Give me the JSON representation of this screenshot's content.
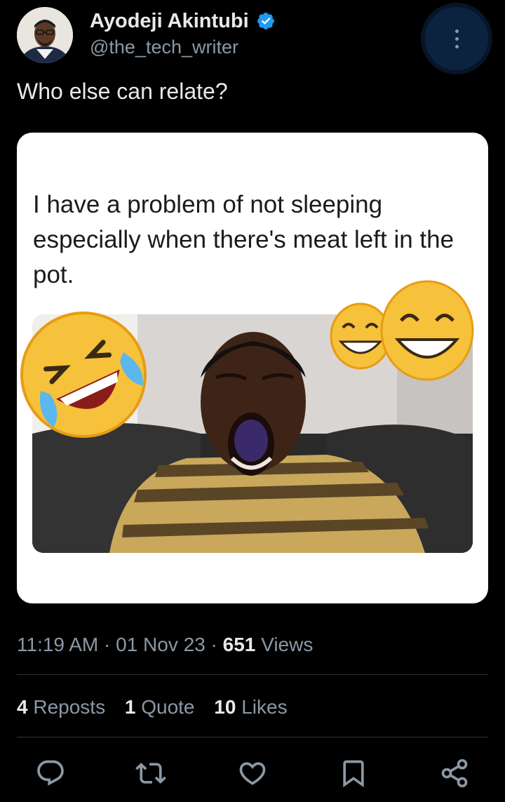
{
  "author": {
    "display_name": "Ayodeji Akintubi",
    "handle": "@the_tech_writer",
    "verified": true,
    "avatar_icon": "profile-photo"
  },
  "tweet": {
    "text": "Who else can relate?",
    "media": {
      "caption": "I have a problem of not sleeping especially when there's meat left in the pot.",
      "emojis": [
        "rolling-on-floor-laughing",
        "beaming-face",
        "beaming-face"
      ]
    }
  },
  "meta": {
    "time": "11:19 AM",
    "separator": "·",
    "date": "01 Nov 23",
    "views_count": "651",
    "views_label": "Views"
  },
  "stats": {
    "reposts_count": "4",
    "reposts_label": "Reposts",
    "quotes_count": "1",
    "quotes_label": "Quote",
    "likes_count": "10",
    "likes_label": "Likes"
  },
  "actions": [
    "reply-icon",
    "repost-icon",
    "like-icon",
    "bookmark-icon",
    "share-icon"
  ],
  "colors": {
    "background": "#000000",
    "text_primary": "#e7e9ea",
    "text_secondary": "#8b98a5",
    "verified": "#1d9bf0",
    "divider": "#2f3336"
  }
}
